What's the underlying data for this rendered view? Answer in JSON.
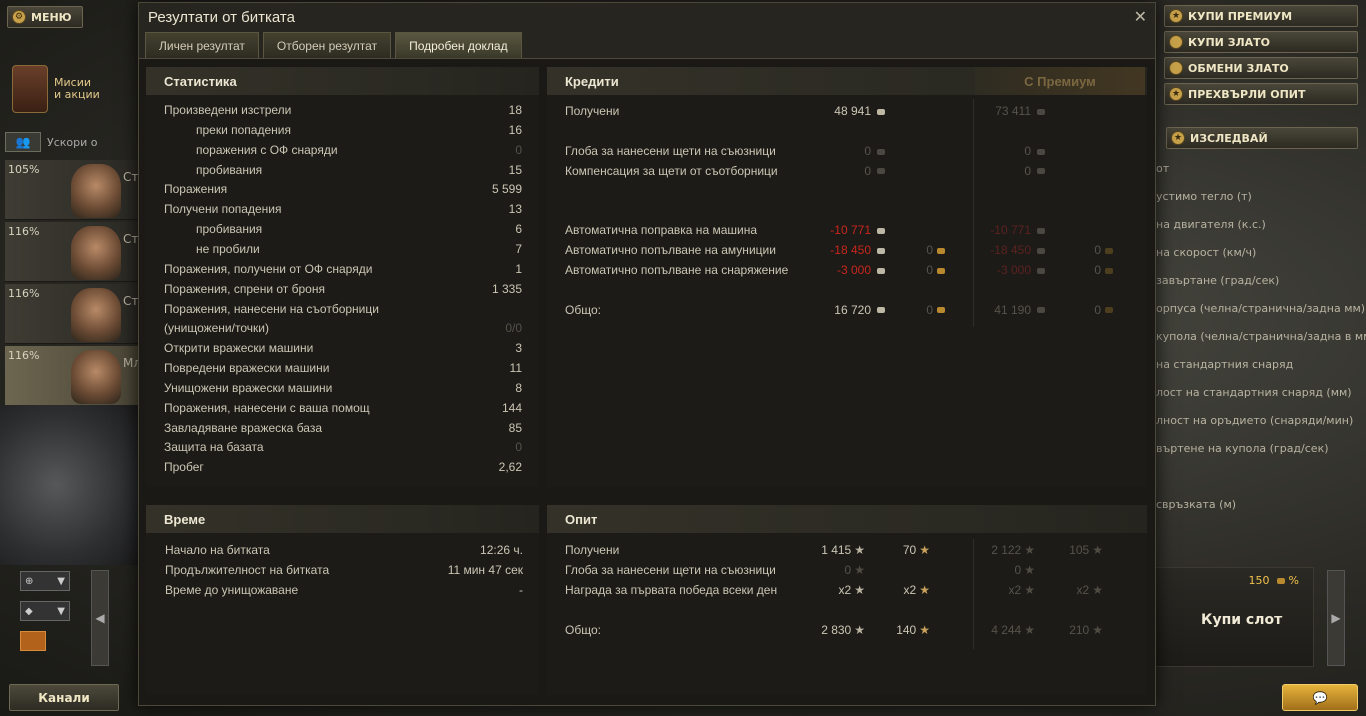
{
  "background": {
    "menu_label": "МЕНЮ",
    "missions_label_1": "Мисии",
    "missions_label_2": "и акции",
    "crew_filter_label": "Ускори о",
    "crew": [
      {
        "pct": "105%",
        "name": "Ст"
      },
      {
        "pct": "116%",
        "name": "Ст"
      },
      {
        "pct": "116%",
        "name": "Ст"
      },
      {
        "pct": "116%",
        "name": "Мл"
      }
    ],
    "right_buttons": [
      "КУПИ ПРЕМИУМ",
      "КУПИ ЗЛАТО",
      "ОБМЕНИ ЗЛАТО",
      "ПРЕХВЪРЛИ ОПИТ"
    ],
    "research_label": "ИЗСЛЕДВАЙ",
    "specs": [
      "от",
      "устимо тегло (т)",
      "на двигателя (к.с.)",
      "на скорост (км/ч)",
      "завъртане (град/сек)",
      "орпуса (челна/странична/задна мм)",
      "купола (челна/странична/задна в мм)",
      "на стандартния снаряд",
      "лост на стандартния снаряд (мм)",
      "лност на оръдието (снаряди/мин)",
      "въртене на купола (град/сек)",
      "свръзката (м)"
    ],
    "slot_price": "150",
    "slot_price_suffix": "%",
    "slot_label": "Купи слот",
    "channels_label": "Канали"
  },
  "window": {
    "title": "Резултати от битката",
    "close": "✕",
    "tabs": [
      "Личен резултат",
      "Отборен резултат",
      "Подробен доклад"
    ],
    "active_tab": 2
  },
  "statistics": {
    "header": "Статистика",
    "rows": [
      {
        "label": "Произведени изстрели",
        "value": "18",
        "indent": false
      },
      {
        "label": "преки попадения",
        "value": "16",
        "indent": true
      },
      {
        "label": "поражения с ОФ снаряди",
        "value": "0",
        "indent": true
      },
      {
        "label": "пробивания",
        "value": "15",
        "indent": true
      },
      {
        "label": "Поражения",
        "value": "5 599",
        "indent": false
      },
      {
        "label": "Получени попадения",
        "value": "13",
        "indent": false
      },
      {
        "label": "пробивания",
        "value": "6",
        "indent": true
      },
      {
        "label": "не пробили",
        "value": "7",
        "indent": true
      },
      {
        "label": "Поражения, получени от ОФ снаряди",
        "value": "1",
        "indent": false
      },
      {
        "label": "Поражения, спрени от броня",
        "value": "1 335",
        "indent": false
      },
      {
        "label": "Поражения, нанесени на съотборници",
        "value": "",
        "indent": false
      },
      {
        "label": "(унищожени/точки)",
        "value": "0/0",
        "indent": false
      },
      {
        "label": "Открити вражески машини",
        "value": "3",
        "indent": false
      },
      {
        "label": "Повредени вражески машини",
        "value": "11",
        "indent": false
      },
      {
        "label": "Унищожени вражески машини",
        "value": "8",
        "indent": false
      },
      {
        "label": "Поражения, нанесени с ваша помощ",
        "value": "144",
        "indent": false
      },
      {
        "label": "Завладяване вражеска база",
        "value": "85",
        "indent": false
      },
      {
        "label": "Защита на базата",
        "value": "0",
        "indent": false
      },
      {
        "label": "Пробег",
        "value": "2,62",
        "indent": false
      }
    ]
  },
  "credits": {
    "header": "Кредити",
    "premium_header": "С Премиум",
    "rows": [
      {
        "label": "Получени",
        "credits": "48 941",
        "gold": "",
        "prem_credits": "73 411",
        "prem_gold": ""
      },
      {
        "label": "",
        "credits": "",
        "gold": "",
        "prem_credits": "",
        "prem_gold": ""
      },
      {
        "label": "Глоба за нанесени щети на съюзници",
        "credits": "0",
        "gold": "",
        "prem_credits": "0",
        "prem_gold": ""
      },
      {
        "label": "Компенсация за щети от съотборници",
        "credits": "0",
        "gold": "",
        "prem_credits": "0",
        "prem_gold": ""
      },
      {
        "label": "",
        "credits": "",
        "gold": "",
        "prem_credits": "",
        "prem_gold": ""
      },
      {
        "label": "",
        "credits": "",
        "gold": "",
        "prem_credits": "",
        "prem_gold": ""
      },
      {
        "label": "Автоматична поправка на машина",
        "credits": "-10 771",
        "gold": "",
        "prem_credits": "-10 771",
        "prem_gold": ""
      },
      {
        "label": "Автоматично попълване на амуниции",
        "credits": "-18 450",
        "gold": "0",
        "prem_credits": "-18 450",
        "prem_gold": "0"
      },
      {
        "label": "Автоматично попълване на снаряжение",
        "credits": "-3 000",
        "gold": "0",
        "prem_credits": "-3 000",
        "prem_gold": "0"
      },
      {
        "label": "",
        "credits": "",
        "gold": "",
        "prem_credits": "",
        "prem_gold": ""
      },
      {
        "label": "Общо:",
        "credits": "16 720",
        "gold": "0",
        "prem_credits": "41 190",
        "prem_gold": "0"
      }
    ]
  },
  "time": {
    "header": "Време",
    "rows": [
      {
        "label": "Начало на битката",
        "value": "12:26 ч."
      },
      {
        "label": "Продължителност на битката",
        "value": "11 мин 47 сек"
      },
      {
        "label": "Време до унищожаване",
        "value": "-"
      }
    ]
  },
  "experience": {
    "header": "Опит",
    "rows": [
      {
        "label": "Получени",
        "xp": "1 415",
        "free_xp": "70",
        "prem_xp": "2 122",
        "prem_free_xp": "105"
      },
      {
        "label": "Глоба за нанесени щети на съюзници",
        "xp": "0",
        "free_xp": "",
        "prem_xp": "0",
        "prem_free_xp": ""
      },
      {
        "label": "Награда за първата победа всеки ден",
        "xp": "x2",
        "free_xp": "x2",
        "prem_xp": "x2",
        "prem_free_xp": "x2"
      },
      {
        "label": "",
        "xp": "",
        "free_xp": "",
        "prem_xp": "",
        "prem_free_xp": ""
      },
      {
        "label": "Общо:",
        "xp": "2 830",
        "free_xp": "140",
        "prem_xp": "4 244",
        "prem_free_xp": "210"
      }
    ]
  },
  "colors": {
    "negative": "#c9261e",
    "gold": "#b8892e",
    "accent": "#e6b33c"
  }
}
